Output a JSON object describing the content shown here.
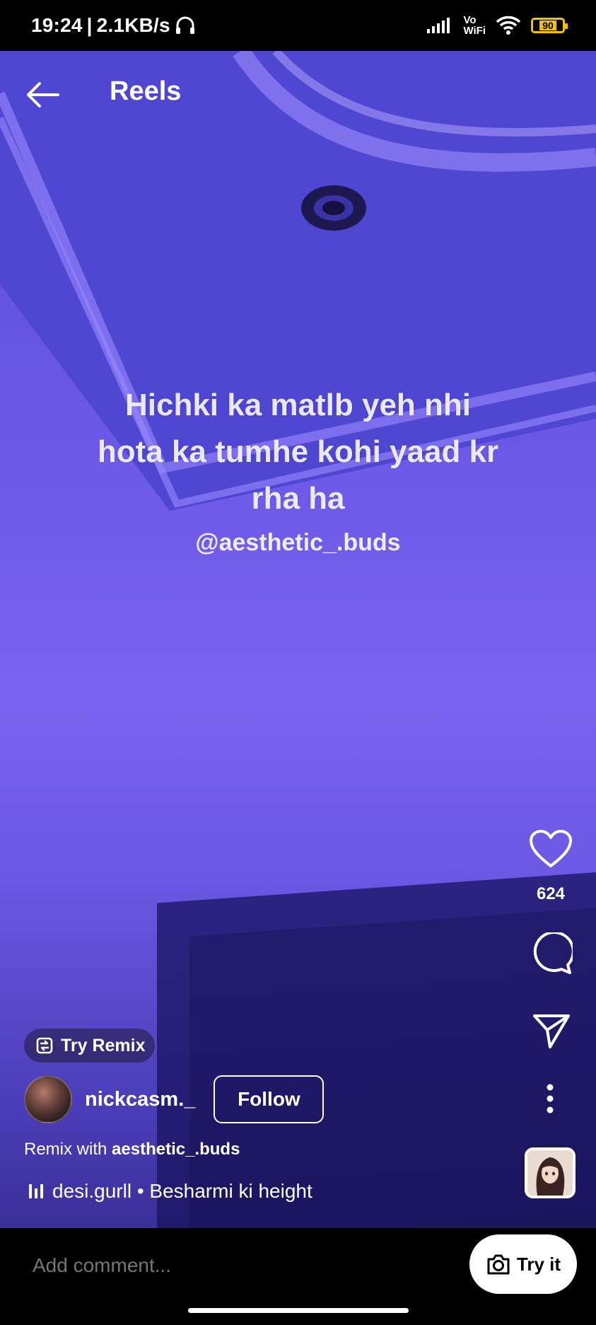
{
  "status_bar": {
    "time": "19:24",
    "speed": "2.1KB/s",
    "vo_top": "Vo",
    "vo_bottom": "WiFi",
    "battery": "90"
  },
  "header": {
    "title": "Reels",
    "back_icon": "arrow-left-icon"
  },
  "video": {
    "caption_line1": "Hichki ka matlb yeh nhi",
    "caption_line2": "hota ka tumhe kohi yaad kr",
    "caption_line3": "rha ha",
    "caption_handle": "@aesthetic_.buds"
  },
  "actions": {
    "like_count": "624",
    "icons": [
      "heart-icon",
      "comment-icon",
      "share-icon",
      "more-icon"
    ]
  },
  "post": {
    "try_remix_label": "Try Remix",
    "username": "nickcasm._",
    "follow_label": "Follow",
    "remix_prefix": "Remix with",
    "remix_user": "aesthetic_.buds",
    "audio": "desi.gurll • Besharmi ki height"
  },
  "composer": {
    "placeholder": "Add comment...",
    "try_it_label": "Try it"
  },
  "colors": {
    "video_top": "#5a4fd9",
    "video_mid": "#7a63ee",
    "video_bottom": "#3b2f98",
    "battery": "#f2c200"
  }
}
